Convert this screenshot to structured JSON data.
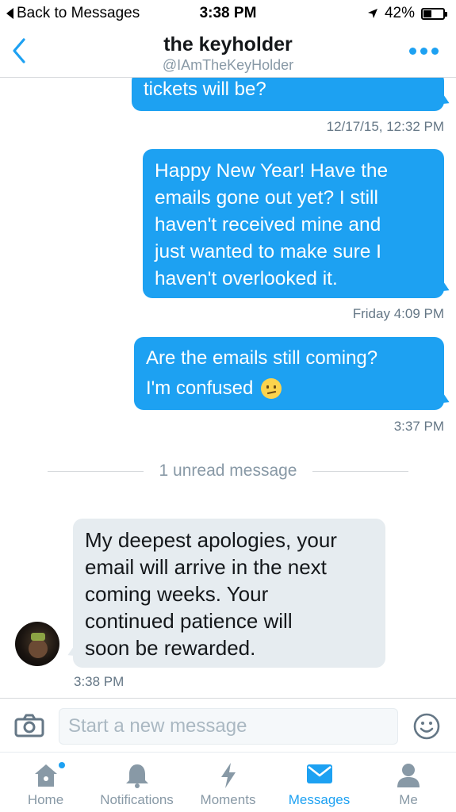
{
  "status_bar": {
    "back_label": "Back to Messages",
    "time": "3:38 PM",
    "battery": "42%",
    "battery_level": 0.42
  },
  "header": {
    "title": "the keyholder",
    "handle": "@IAmTheKeyHolder",
    "back_icon": "chevron-left-icon",
    "more_icon": "more-dots-icon"
  },
  "messages": [
    {
      "direction": "outgoing",
      "lines": [
        "tickets will be?"
      ],
      "timestamp": "12/17/15, 12:32 PM"
    },
    {
      "direction": "outgoing",
      "lines": [
        "Happy New Year! Have the",
        "emails gone out yet? I still",
        "haven't received mine and",
        "just wanted to make sure I",
        "haven't overlooked it."
      ],
      "timestamp": "Friday 4:09 PM"
    },
    {
      "direction": "outgoing",
      "lines": [
        "Are the emails still coming?",
        "I'm confused"
      ],
      "emoji": "😕",
      "timestamp": "3:37 PM"
    },
    {
      "direction": "incoming",
      "lines": [
        "My deepest apologies, your",
        "email will arrive in the next",
        "coming weeks. Your",
        "continued patience will",
        "soon be rewarded."
      ],
      "timestamp": "3:38 PM"
    }
  ],
  "unread_divider": "1 unread message",
  "composer": {
    "placeholder": "Start a new message",
    "camera_icon": "camera-icon",
    "emoji_icon": "smiley-icon"
  },
  "tabs": [
    {
      "label": "Home",
      "icon": "home-icon",
      "active": false,
      "badge": true
    },
    {
      "label": "Notifications",
      "icon": "bell-icon",
      "active": false
    },
    {
      "label": "Moments",
      "icon": "lightning-icon",
      "active": false
    },
    {
      "label": "Messages",
      "icon": "envelope-icon",
      "active": true
    },
    {
      "label": "Me",
      "icon": "person-icon",
      "active": false
    }
  ],
  "colors": {
    "accent": "#1da1f2",
    "incoming_bubble": "#e6ecf0",
    "muted_text": "#8899a6"
  }
}
